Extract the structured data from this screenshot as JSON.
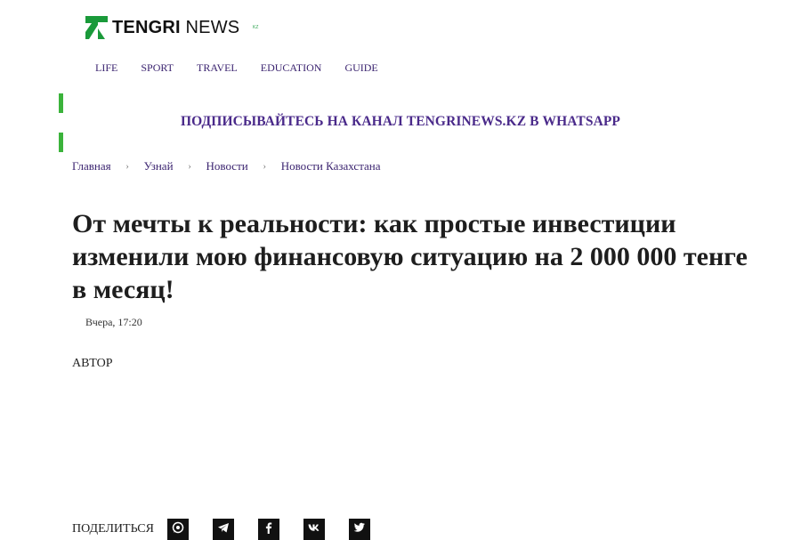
{
  "header": {
    "logo_bold": "TENGRI",
    "logo_light": "NEWS",
    "logo_suffix": "KZ"
  },
  "nav": {
    "items": [
      "LIFE",
      "SPORT",
      "TRAVEL",
      "EDUCATION",
      "GUIDE"
    ]
  },
  "banner": {
    "text": "ПОДПИСЫВАЙТЕСЬ НА КАНАЛ TENGRINEWS.KZ В WHATSAPP"
  },
  "breadcrumb": {
    "items": [
      "Главная",
      "Узнай",
      "Новости",
      "Новости Казахстана"
    ],
    "separator": "›"
  },
  "article": {
    "title": "От мечты к реальности: как простые инвестиции изменили мою финансовую ситуацию на 2 000 000 тенге в месяц!",
    "date": "Вчера, 17:20",
    "author_label": "АВТОР"
  },
  "share": {
    "label": "ПОДЕЛИТЬСЯ",
    "icons": [
      "whatsapp-icon",
      "telegram-icon",
      "facebook-icon",
      "vk-icon",
      "twitter-icon"
    ]
  },
  "colors": {
    "brand_green": "#1a9a3a",
    "nav_link": "#3b2470",
    "banner_text": "#4a2a8a",
    "banner_bar": "#3bb33b"
  }
}
